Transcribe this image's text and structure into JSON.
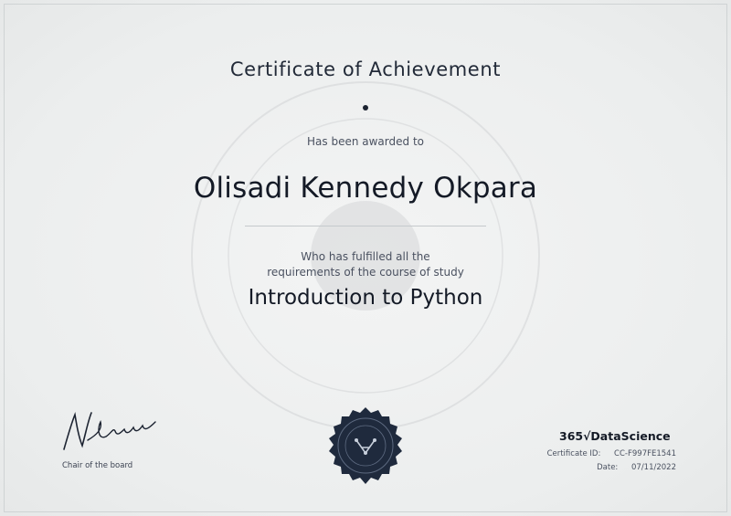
{
  "certificate": {
    "title": "Certificate of Achievement",
    "awarded_text": "Has been awarded to",
    "recipient_name": "Olisadi Kennedy Okpara",
    "fulfilled_line1": "Who has fulfilled all the",
    "fulfilled_line2": "requirements of the course of study",
    "course_name": "Introduction to Python"
  },
  "signatory": {
    "role": "Chair of the board"
  },
  "issuer": {
    "brand": "365√DataScience",
    "certificate_id_label": "Certificate ID:",
    "certificate_id": "CC-F997FE1541",
    "date_label": "Date:",
    "date": "07/11/2022"
  },
  "colors": {
    "ink": "#141a26",
    "seal": "#1f2a3d",
    "background": "#eceeee"
  }
}
